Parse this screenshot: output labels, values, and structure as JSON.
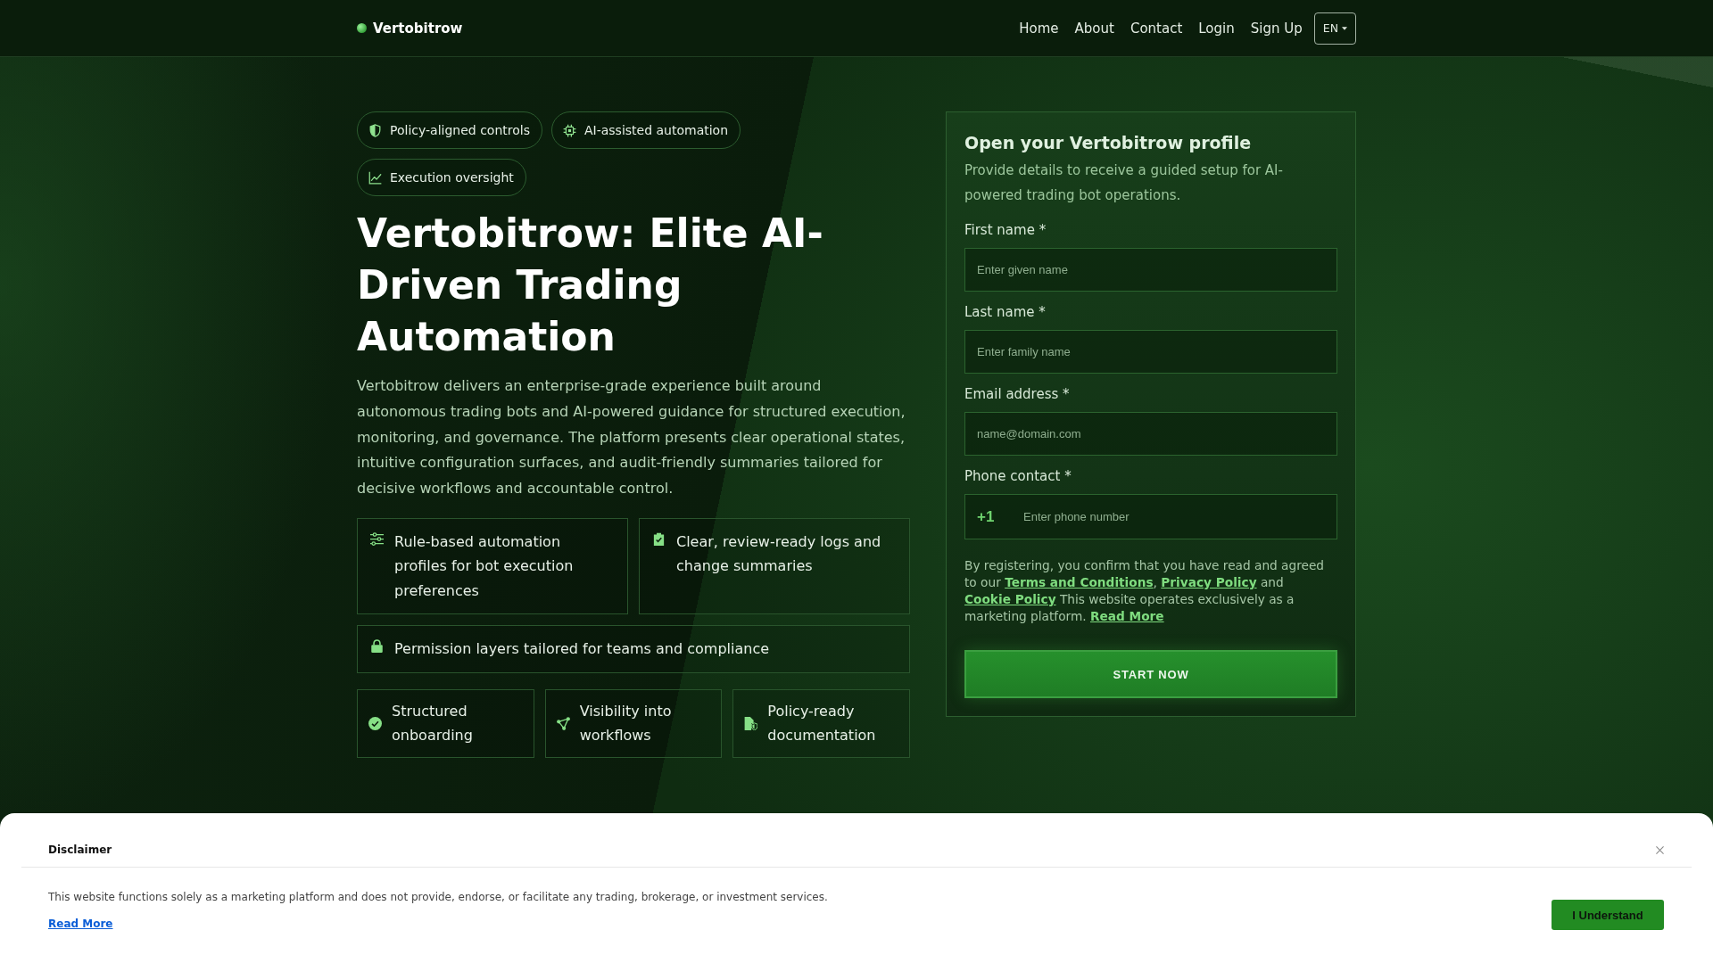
{
  "nav": {
    "brand": "Vertobitrow",
    "links": [
      "Home",
      "About",
      "Contact",
      "Login",
      "Sign Up"
    ],
    "language": "EN"
  },
  "hero": {
    "chips": [
      "Policy-aligned controls",
      "AI-assisted automation",
      "Execution oversight"
    ],
    "title": "Vertobitrow: Elite AI-Driven Trading Automation",
    "description": "Vertobitrow delivers an enterprise-grade experience built around autonomous trading bots and AI-powered guidance for structured execution, monitoring, and governance. The platform presents clear operational states, intuitive configuration surfaces, and audit-friendly summaries tailored for decisive workflows and accountable control.",
    "feature_rows": [
      [
        "Rule-based automation profiles for bot execution preferences",
        "Clear, review-ready logs and change summaries"
      ],
      [
        "Permission layers tailored for teams and compliance"
      ],
      [
        "Structured onboarding",
        "Visibility into workflows",
        "Policy-ready documentation"
      ]
    ]
  },
  "form": {
    "title": "Open your Vertobitrow profile",
    "subtitle": "Provide details to receive a guided setup for AI-powered trading bot operations.",
    "fields": [
      {
        "label": "First name *",
        "placeholder": "Enter given name"
      },
      {
        "label": "Last name *",
        "placeholder": "Enter family name"
      },
      {
        "label": "Email address *",
        "placeholder": "name@domain.com"
      },
      {
        "label": "Phone contact *",
        "prefix": "+1",
        "placeholder": "Enter phone number"
      }
    ],
    "consent": [
      {
        "kind": "text",
        "text": "By registering, you confirm that you have read and agreed to our "
      },
      {
        "kind": "link",
        "text": "Terms and Conditions"
      },
      {
        "kind": "text",
        "text": ", "
      },
      {
        "kind": "link",
        "text": "Privacy Policy"
      },
      {
        "kind": "text",
        "text": " and "
      },
      {
        "kind": "link",
        "text": "Cookie Policy"
      },
      {
        "kind": "text",
        "text": " This website operates exclusively as a marketing platform. "
      },
      {
        "kind": "link",
        "text": "Read More"
      }
    ],
    "submit": "START NOW"
  },
  "disclaimer": {
    "title": "Disclaimer",
    "text": "This website functions solely as a marketing platform and does not provide, endorse, or facilitate any trading, brokerage, or investment services.",
    "link": "Read More",
    "button": "I Understand"
  }
}
